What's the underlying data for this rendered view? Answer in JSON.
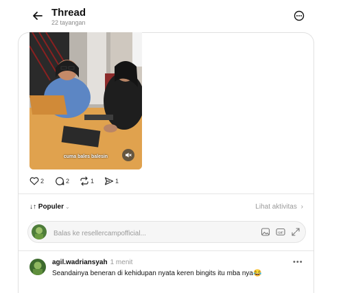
{
  "header": {
    "title": "Thread",
    "views": "22 tayangan",
    "back_icon": "arrow-left-icon",
    "more_icon": "more-circle-icon"
  },
  "post": {
    "video_caption": "cuma bales balesin",
    "mute_icon": "speaker-muted-icon",
    "stats": {
      "likes": "2",
      "comments": "2",
      "reposts": "1",
      "shares": "1"
    }
  },
  "replies_header": {
    "sort_label": "Populer",
    "activity_label": "Lihat aktivitas"
  },
  "reply_box": {
    "placeholder": "Balas ke resellercampofficial..."
  },
  "comment": {
    "username": "agil.wadriansyah",
    "time": "1 menit",
    "text": "Seandainya beneran di kehidupan nyata keren bingits itu mba nya😂"
  },
  "colors": {
    "accent_text": "#101010",
    "muted_text": "#999999",
    "border": "#e0e0e0"
  }
}
